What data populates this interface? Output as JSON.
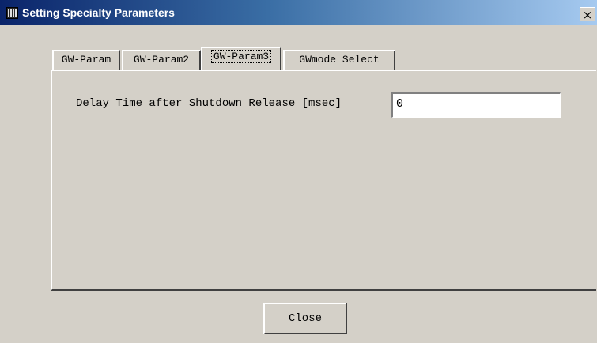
{
  "window": {
    "title": "Setting Specialty Parameters",
    "close_glyph": "×"
  },
  "tabs": [
    {
      "label": "GW-Param",
      "active": false
    },
    {
      "label": "GW-Param2",
      "active": false
    },
    {
      "label": "GW-Param3",
      "active": true
    },
    {
      "label": "GWmode Select",
      "active": false
    }
  ],
  "panel": {
    "delay_label": "Delay Time after Shutdown Release [msec]",
    "delay_value": "0"
  },
  "footer": {
    "close_label": "Close"
  }
}
